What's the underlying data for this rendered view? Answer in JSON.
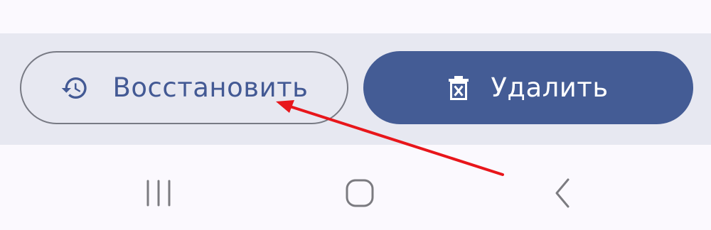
{
  "actions": {
    "restore": {
      "label": "Восстановить",
      "icon": "history-icon"
    },
    "delete": {
      "label": "Удалить",
      "icon": "trash-icon"
    }
  },
  "nav": {
    "recents": {
      "icon": "recent-apps-icon"
    },
    "home": {
      "icon": "home-icon"
    },
    "back": {
      "icon": "back-icon"
    }
  },
  "colors": {
    "accent": "#445c95",
    "restore_text": "#435994",
    "outline": "#787a84",
    "action_bar_bg": "#e7e8f1",
    "page_bg": "#fbf9fe",
    "nav_icon": "#7b7b80",
    "annotation_arrow": "#e8161b"
  }
}
